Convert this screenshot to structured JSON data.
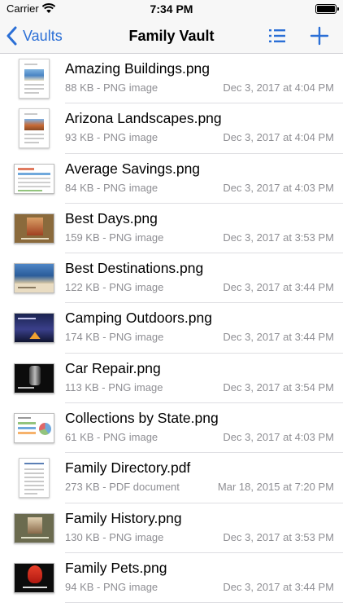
{
  "status": {
    "carrier": "Carrier",
    "time": "7:34 PM"
  },
  "nav": {
    "back_label": "Vaults",
    "title": "Family Vault"
  },
  "colors": {
    "accent": "#2b6fd6",
    "secondary_text": "#8e8e93",
    "separator": "#dedee2",
    "bar_background": "#f7f7f7"
  },
  "files": [
    {
      "name": "Amazing Buildings.png",
      "meta": "88 KB - PNG image",
      "date": "Dec 3, 2017 at 4:04 PM",
      "thumb": "document-icon"
    },
    {
      "name": "Arizona Landscapes.png",
      "meta": "93 KB - PNG image",
      "date": "Dec 3, 2017 at 4:04 PM",
      "thumb": "document-icon"
    },
    {
      "name": "Average Savings.png",
      "meta": "84 KB - PNG image",
      "date": "Dec 3, 2017 at 4:03 PM",
      "thumb": "spreadsheet-thumbnail"
    },
    {
      "name": "Best Days.png",
      "meta": "159 KB - PNG image",
      "date": "Dec 3, 2017 at 3:53 PM",
      "thumb": "photo-slide-thumbnail"
    },
    {
      "name": "Best Destinations.png",
      "meta": "122 KB - PNG image",
      "date": "Dec 3, 2017 at 3:44 PM",
      "thumb": "landscape-slide-thumbnail"
    },
    {
      "name": "Camping Outdoors.png",
      "meta": "174 KB - PNG image",
      "date": "Dec 3, 2017 at 3:44 PM",
      "thumb": "night-sky-thumbnail"
    },
    {
      "name": "Car Repair.png",
      "meta": "113 KB - PNG image",
      "date": "Dec 3, 2017 at 3:54 PM",
      "thumb": "dark-slide-thumbnail"
    },
    {
      "name": "Collections by State.png",
      "meta": "61 KB - PNG image",
      "date": "Dec 3, 2017 at 4:03 PM",
      "thumb": "chart-slide-thumbnail"
    },
    {
      "name": "Family Directory.pdf",
      "meta": "273 KB - PDF document",
      "date": "Mar 18, 2015 at 7:20 PM",
      "thumb": "pdf-document-icon"
    },
    {
      "name": "Family History.png",
      "meta": "130 KB - PNG image",
      "date": "Dec 3, 2017 at 3:53 PM",
      "thumb": "photo-slide-thumbnail"
    },
    {
      "name": "Family Pets.png",
      "meta": "94 KB - PNG image",
      "date": "Dec 3, 2017 at 3:44 PM",
      "thumb": "parrot-slide-thumbnail"
    }
  ]
}
